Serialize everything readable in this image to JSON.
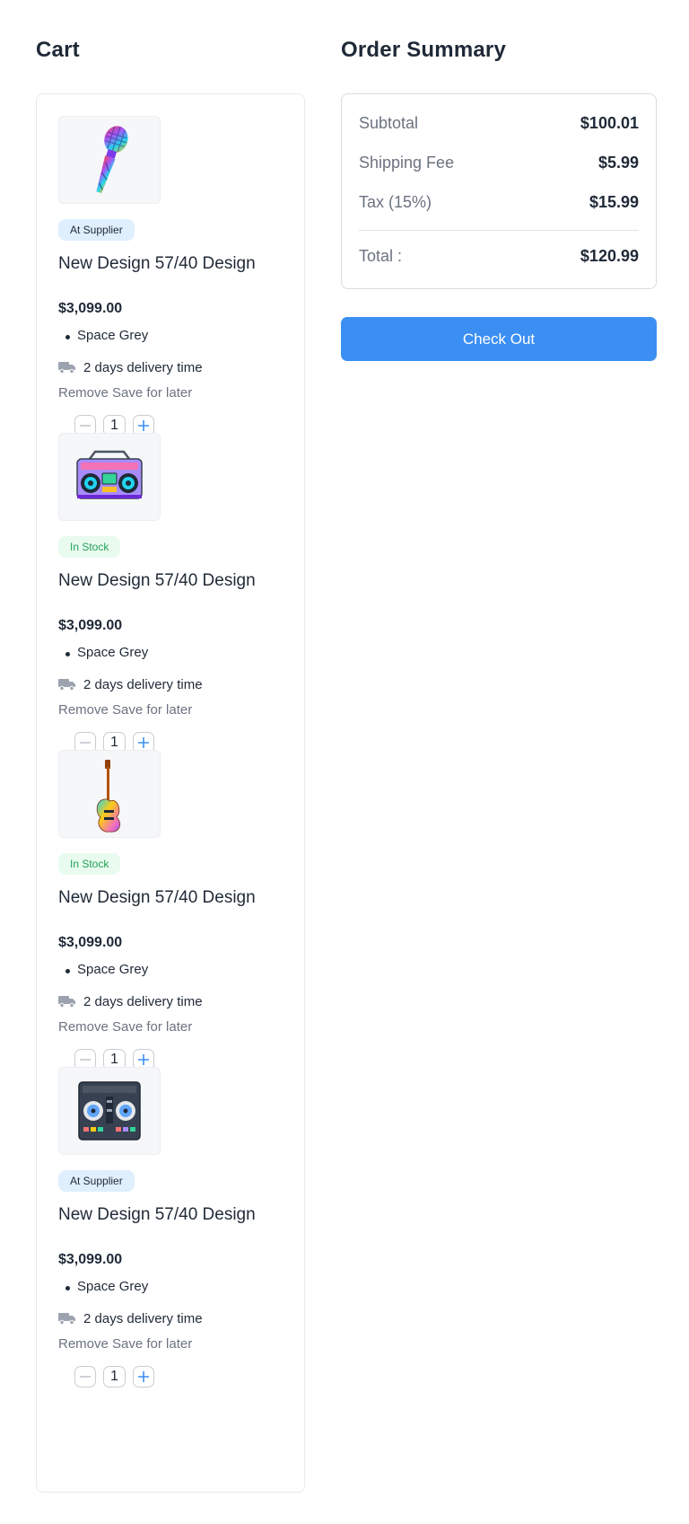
{
  "cart": {
    "title": "Cart",
    "items": [
      {
        "icon": "microphone-icon",
        "badge": "At Supplier",
        "badge_type": "supplier",
        "title": "New Design 57/40 Design",
        "price": "$3,099.00",
        "variant": "Space Grey",
        "delivery": "2 days delivery time",
        "remove_label": "Remove",
        "save_label": "Save for later",
        "quantity": "1"
      },
      {
        "icon": "boombox-icon",
        "badge": "In Stock",
        "badge_type": "stock",
        "title": "New Design 57/40 Design",
        "price": "$3,099.00",
        "variant": "Space Grey",
        "delivery": "2 days delivery time",
        "remove_label": "Remove",
        "save_label": "Save for later",
        "quantity": "1"
      },
      {
        "icon": "guitar-icon",
        "badge": "In Stock",
        "badge_type": "stock",
        "title": "New Design 57/40 Design",
        "price": "$3,099.00",
        "variant": "Space Grey",
        "delivery": "2 days delivery time",
        "remove_label": "Remove",
        "save_label": "Save for later",
        "quantity": "1"
      },
      {
        "icon": "dj-controller-icon",
        "badge": "At Supplier",
        "badge_type": "supplier",
        "title": "New Design 57/40 Design",
        "price": "$3,099.00",
        "variant": "Space Grey",
        "delivery": "2 days delivery time",
        "remove_label": "Remove",
        "save_label": "Save for later",
        "quantity": "1"
      }
    ]
  },
  "summary": {
    "title": "Order Summary",
    "subtotal_label": "Subtotal",
    "subtotal_value": "$100.01",
    "shipping_label": "Shipping Fee",
    "shipping_value": "$5.99",
    "tax_label": "Tax (15%)",
    "tax_value": "$15.99",
    "total_label": "Total :",
    "total_value": "$120.99",
    "checkout_label": "Check Out"
  },
  "colors": {
    "accent": "#3b8ff3",
    "supplier_badge_bg": "#e0effd",
    "stock_badge_bg": "#e9fbef",
    "stock_badge_text": "#22a05a"
  }
}
